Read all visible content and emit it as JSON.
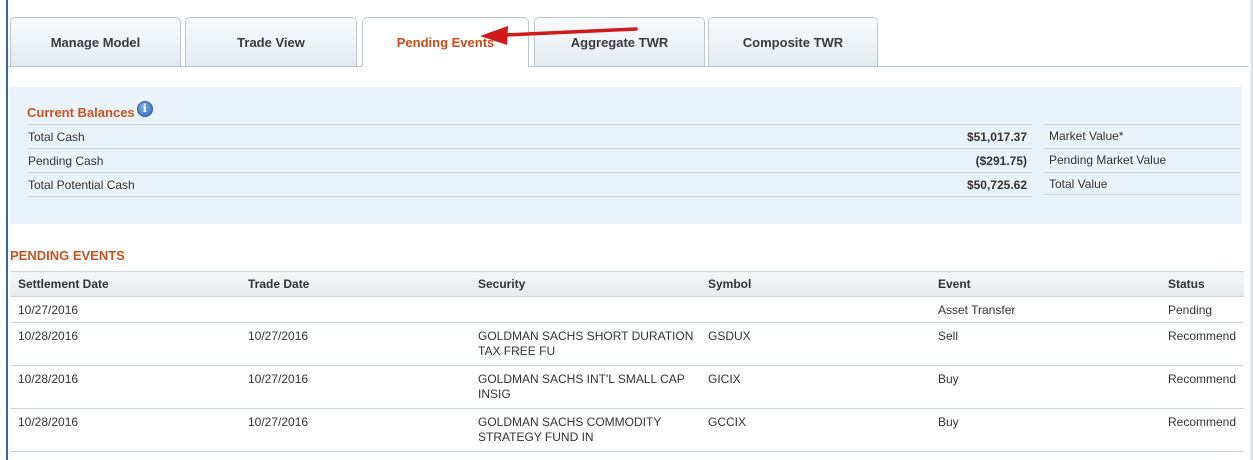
{
  "tabs": [
    {
      "label": "Manage Model",
      "active": false
    },
    {
      "label": "Trade View",
      "active": false
    },
    {
      "label": "Pending Events",
      "active": true
    },
    {
      "label": "Aggregate TWR",
      "active": false
    },
    {
      "label": "Composite TWR",
      "active": false
    }
  ],
  "annotation": {
    "arrow_color": "#d01a1a"
  },
  "balances": {
    "title": "Current Balances",
    "info_icon": "info-icon",
    "rows": [
      {
        "label": "Total Cash",
        "amount": "$51,017.37"
      },
      {
        "label": "Pending Cash",
        "amount": "($291.75)"
      },
      {
        "label": "Total Potential Cash",
        "amount": "$50,725.62"
      }
    ],
    "market_rows": [
      {
        "label": "Market Value*"
      },
      {
        "label": "Pending Market Value"
      },
      {
        "label": "Total Value"
      }
    ]
  },
  "pending_events": {
    "title": "PENDING EVENTS",
    "columns": [
      "Settlement Date",
      "Trade Date",
      "Security",
      "Symbol",
      "Event",
      "Status"
    ],
    "rows": [
      {
        "settlement_date": "10/27/2016",
        "trade_date": "",
        "security": "",
        "symbol": "",
        "event": "Asset Transfer",
        "status": "Pending"
      },
      {
        "settlement_date": "10/28/2016",
        "trade_date": "10/27/2016",
        "security": "GOLDMAN SACHS SHORT DURATION TAX FREE FU",
        "symbol": "GSDUX",
        "event": "Sell",
        "status": "Recommend"
      },
      {
        "settlement_date": "10/28/2016",
        "trade_date": "10/27/2016",
        "security": "GOLDMAN SACHS INT'L SMALL CAP INSIG",
        "symbol": "GICIX",
        "event": "Buy",
        "status": "Recommend"
      },
      {
        "settlement_date": "10/28/2016",
        "trade_date": "10/27/2016",
        "security": "GOLDMAN SACHS COMMODITY STRATEGY FUND IN",
        "symbol": "GCCIX",
        "event": "Buy",
        "status": "Recommend"
      }
    ]
  },
  "colors": {
    "accent": "#c8531e",
    "active_tab_text": "#cb4a17",
    "panel_bg": "#eaf3f9",
    "frame": "#2f6aa6"
  }
}
